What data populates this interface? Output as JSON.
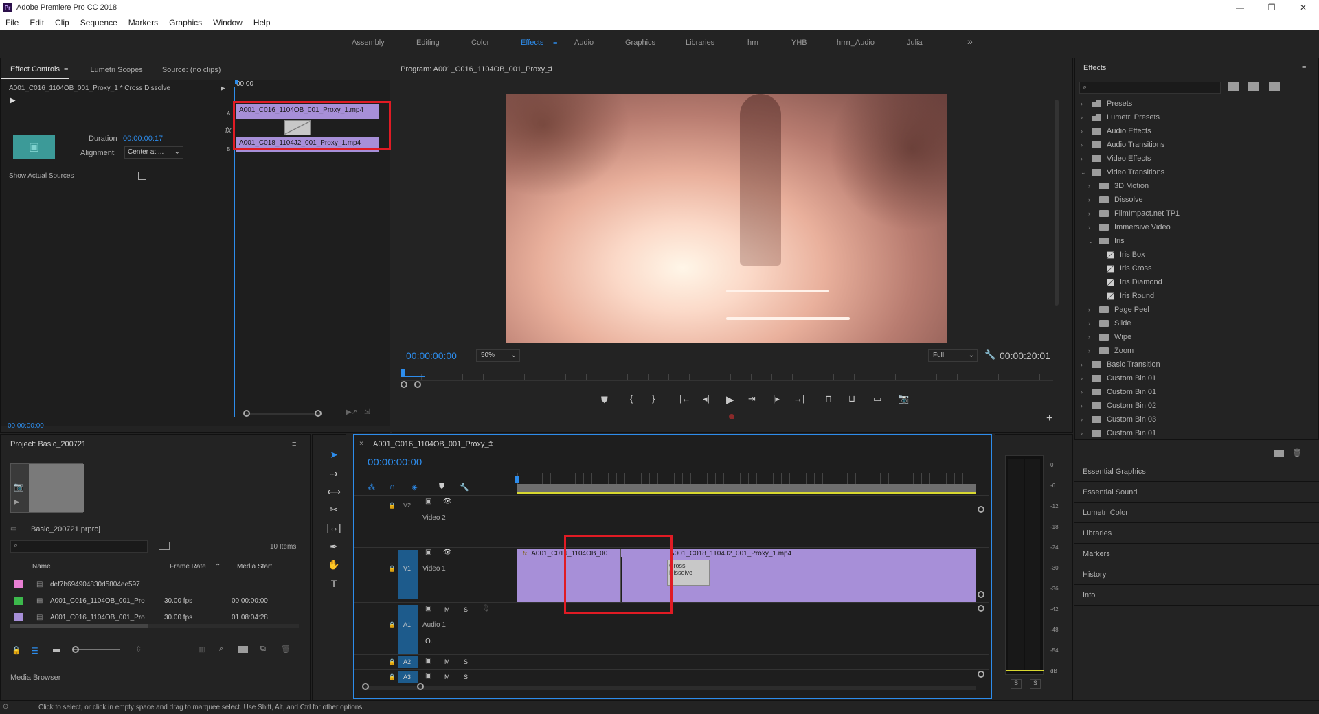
{
  "app": {
    "icon": "Pr",
    "title": "Adobe Premiere Pro CC 2018"
  },
  "menu": [
    "File",
    "Edit",
    "Clip",
    "Sequence",
    "Markers",
    "Graphics",
    "Window",
    "Help"
  ],
  "workspaces": [
    {
      "label": "Assembly",
      "active": false
    },
    {
      "label": "Editing",
      "active": false
    },
    {
      "label": "Color",
      "active": false
    },
    {
      "label": "Effects",
      "active": true
    },
    {
      "label": "Audio",
      "active": false
    },
    {
      "label": "Graphics",
      "active": false
    },
    {
      "label": "Libraries",
      "active": false
    },
    {
      "label": "hrrr",
      "active": false
    },
    {
      "label": "YHB",
      "active": false
    },
    {
      "label": "hrrrr_Audio",
      "active": false
    },
    {
      "label": "Julia",
      "active": false
    }
  ],
  "effect_controls": {
    "tabs": [
      "Effect Controls",
      "Lumetri Scopes",
      "Source: (no clips)"
    ],
    "clip_title": "A001_C016_1104OB_001_Proxy_1 * Cross Dissolve",
    "duration_label": "Duration",
    "duration_value": "00:00:00:17",
    "alignment_label": "Alignment:",
    "alignment_value": "Center at ...",
    "show_actual_sources": "Show Actual Sources",
    "timeline_time": "00:00",
    "clip_a": "A001_C016_1104OB_001_Proxy_1.mp4",
    "clip_b": "A001_C018_1104J2_001_Proxy_1.mp4",
    "track_a": "A",
    "track_b": "B",
    "fx": "fx",
    "footer_time": "00:00:00:00"
  },
  "program": {
    "title": "Program: A001_C016_1104OB_001_Proxy_1",
    "timecode": "00:00:00:00",
    "zoom": "50%",
    "quality": "Full",
    "duration": "00:00:20:01"
  },
  "effects_panel": {
    "title": "Effects",
    "tree": [
      {
        "label": "Presets",
        "type": "preset",
        "level": 0,
        "expanded": false
      },
      {
        "label": "Lumetri Presets",
        "type": "preset",
        "level": 0,
        "expanded": false
      },
      {
        "label": "Audio Effects",
        "type": "folder",
        "level": 0,
        "expanded": false
      },
      {
        "label": "Audio Transitions",
        "type": "folder",
        "level": 0,
        "expanded": false
      },
      {
        "label": "Video Effects",
        "type": "folder",
        "level": 0,
        "expanded": false
      },
      {
        "label": "Video Transitions",
        "type": "folder",
        "level": 0,
        "expanded": true
      },
      {
        "label": "3D Motion",
        "type": "folder",
        "level": 1,
        "expanded": false
      },
      {
        "label": "Dissolve",
        "type": "folder",
        "level": 1,
        "expanded": false
      },
      {
        "label": "FilmImpact.net TP1",
        "type": "folder",
        "level": 1,
        "expanded": false
      },
      {
        "label": "Immersive Video",
        "type": "folder",
        "level": 1,
        "expanded": false
      },
      {
        "label": "Iris",
        "type": "folder",
        "level": 1,
        "expanded": true
      },
      {
        "label": "Iris Box",
        "type": "transition",
        "level": 2
      },
      {
        "label": "Iris Cross",
        "type": "transition",
        "level": 2
      },
      {
        "label": "Iris Diamond",
        "type": "transition",
        "level": 2
      },
      {
        "label": "Iris Round",
        "type": "transition",
        "level": 2
      },
      {
        "label": "Page Peel",
        "type": "folder",
        "level": 1,
        "expanded": false
      },
      {
        "label": "Slide",
        "type": "folder",
        "level": 1,
        "expanded": false
      },
      {
        "label": "Wipe",
        "type": "folder",
        "level": 1,
        "expanded": false
      },
      {
        "label": "Zoom",
        "type": "folder",
        "level": 1,
        "expanded": false
      },
      {
        "label": "Basic Transition",
        "type": "folder",
        "level": 0,
        "expanded": false
      },
      {
        "label": "Custom Bin 01",
        "type": "folder",
        "level": 0,
        "expanded": false
      },
      {
        "label": "Custom Bin 01",
        "type": "folder",
        "level": 0,
        "expanded": false
      },
      {
        "label": "Custom Bin 02",
        "type": "folder",
        "level": 0,
        "expanded": false
      },
      {
        "label": "Custom Bin 03",
        "type": "folder",
        "level": 0,
        "expanded": false
      },
      {
        "label": "Custom Bin 01",
        "type": "folder",
        "level": 0,
        "expanded": false
      }
    ],
    "panels": [
      "Essential Graphics",
      "Essential Sound",
      "Lumetri Color",
      "Libraries",
      "Markers",
      "History",
      "Info"
    ]
  },
  "project": {
    "title": "Project: Basic_200721",
    "file": "Basic_200721.prproj",
    "items": "10 Items",
    "columns": [
      "Name",
      "Frame Rate",
      "Media Start"
    ],
    "rows": [
      {
        "color": "#e87fd3",
        "name": "def7b694904830d5804ee597",
        "rate": "",
        "start": ""
      },
      {
        "color": "#3cb94c",
        "name": "A001_C016_1104OB_001_Pro",
        "rate": "30.00 fps",
        "start": "00:00:00:00"
      },
      {
        "color": "#a78fd8",
        "name": "A001_C016_1104OB_001_Pro",
        "rate": "30.00 fps",
        "start": "01:08:04:28"
      }
    ],
    "media_browser": "Media Browser"
  },
  "timeline": {
    "title": "A001_C016_1104OB_001_Proxy_1",
    "timecode": "00:00:00:00",
    "tracks": {
      "v2": "V2",
      "video2": "Video 2",
      "v1": "V1",
      "video1": "Video 1",
      "a1": "A1",
      "audio1": "Audio 1",
      "a2": "A2",
      "a3": "A3",
      "m": "M",
      "s": "S",
      "o": "O."
    },
    "clip1": "A001_C016_1104OB_00",
    "clip2": "A001_C018_1104J2_001_Proxy_1.mp4",
    "transition": "Cross Dissolve",
    "fx": "fx"
  },
  "meter": {
    "scale": [
      "0",
      "-6",
      "-12",
      "-18",
      "-24",
      "-30",
      "-36",
      "-42",
      "-48",
      "-54",
      "dB"
    ],
    "s1": "S",
    "s2": "S"
  },
  "status": "Click to select, or click in empty space and drag to marquee select. Use Shift, Alt, and Ctrl for other options.",
  "colors": {
    "accent": "#2d8ceb",
    "clip": "#a78fd8",
    "highlight": "#e01b24",
    "track_blue": "#1d5b8c"
  }
}
